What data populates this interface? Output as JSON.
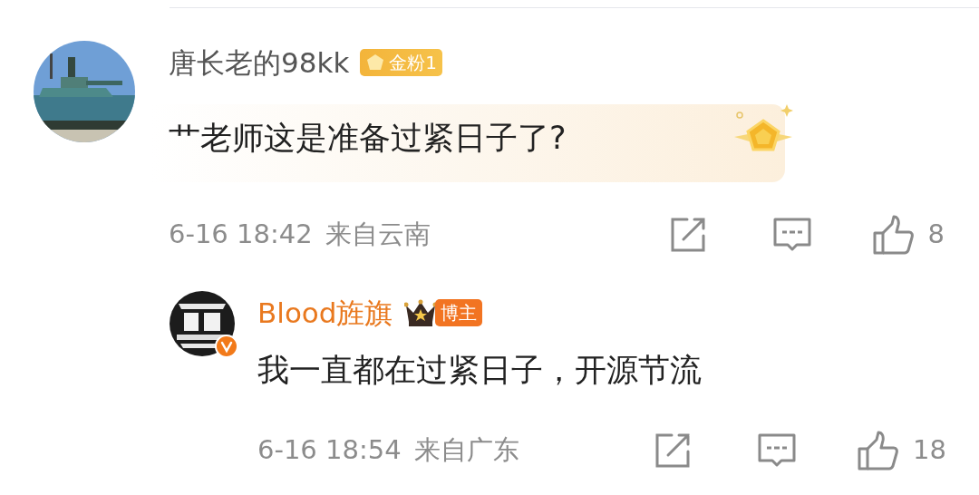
{
  "comments": [
    {
      "username": "唐长老的98kk",
      "author": false,
      "badge": {
        "kind": "fan",
        "label": "金粉1"
      },
      "text": "艹老师这是准备过紧日子了?",
      "fan_card": true,
      "verified": false,
      "time": "6-16 18:42",
      "location": "来自云南",
      "likes": "8",
      "replies": [
        {
          "username": "Blood旌旗",
          "author": true,
          "badge": {
            "kind": "author",
            "label": "博主"
          },
          "text": "我一直都在过紧日子，开源节流",
          "fan_card": false,
          "verified": true,
          "time": "6-16 18:54",
          "location": "来自广东",
          "likes": "18"
        }
      ]
    }
  ]
}
